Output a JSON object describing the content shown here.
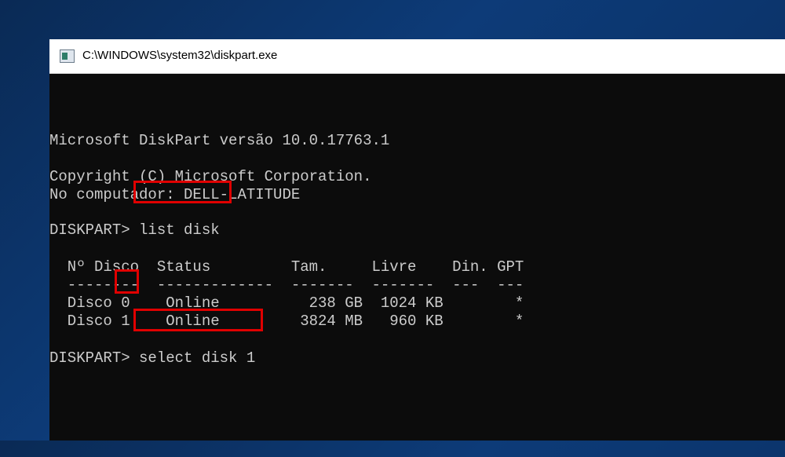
{
  "window": {
    "title": "C:\\WINDOWS\\system32\\diskpart.exe",
    "icon": "console-app-icon"
  },
  "console": {
    "version_line": "Microsoft DiskPart versão 10.0.17763.1",
    "copyright_line": "Copyright (C) Microsoft Corporation.",
    "computer_line": "No computador: DELL-LATITUDE",
    "prompt": "DISKPART>",
    "command1": "list disk",
    "command2": "select disk 1",
    "table": {
      "headers": [
        "Nº Disco",
        "Status",
        "Tam.",
        "Livre",
        "Din.",
        "GPT"
      ],
      "separators": [
        "--------",
        "-------------",
        "-------",
        "-------",
        "---",
        "---"
      ],
      "rows": [
        {
          "label": "Disco",
          "num": "0",
          "status": "Online",
          "size": "238 GB",
          "free": "1024 KB",
          "dyn": "",
          "gpt": "*"
        },
        {
          "label": "Disco",
          "num": "1",
          "status": "Online",
          "size": "3824 MB",
          "free": "960 KB",
          "dyn": "",
          "gpt": "*"
        }
      ]
    }
  },
  "highlight_color": "#e00000"
}
